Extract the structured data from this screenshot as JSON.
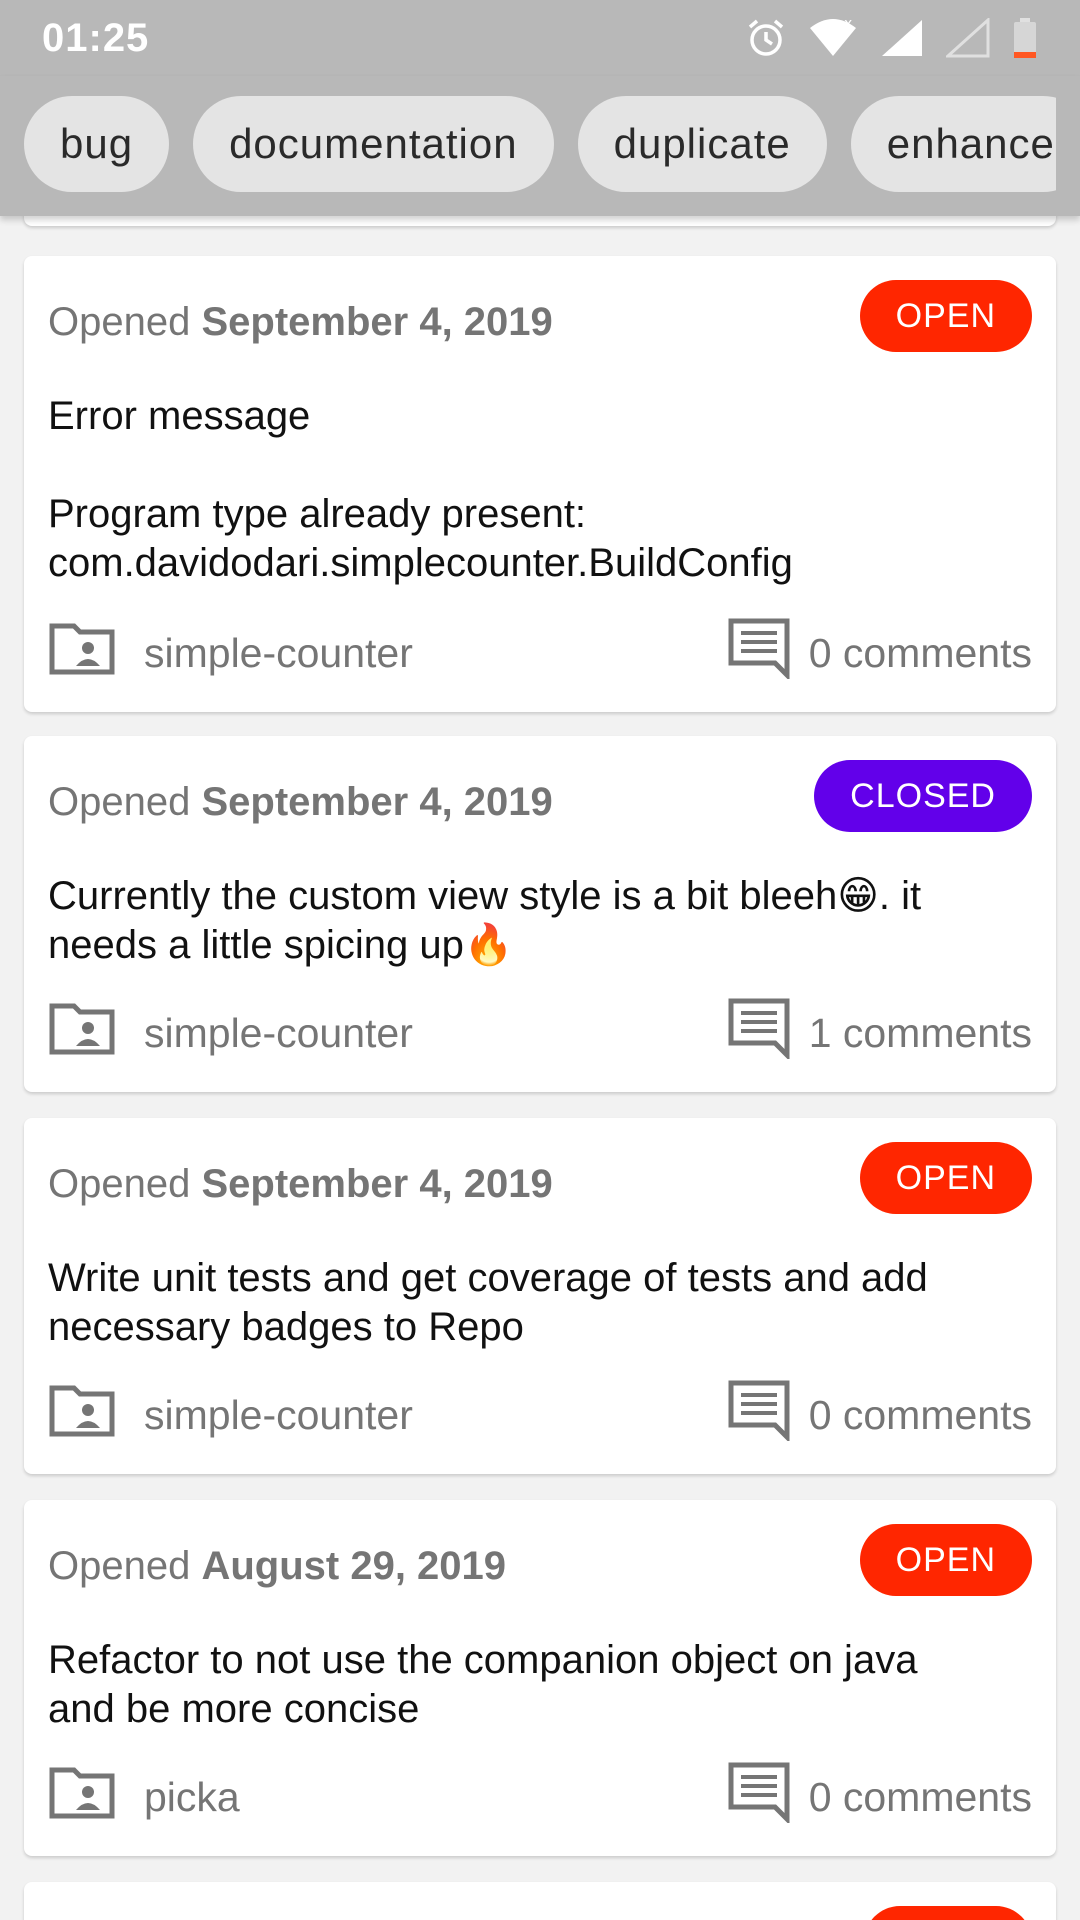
{
  "status_bar": {
    "time": "01:25",
    "icons": [
      "alarm-icon",
      "wifi-icon",
      "signal-icon",
      "signal-empty-icon",
      "battery-low-icon"
    ]
  },
  "label_filters": [
    "bug",
    "documentation",
    "duplicate",
    "enhance"
  ],
  "colors": {
    "open": "#ff2600",
    "closed": "#6200ea",
    "chip_bg": "#e4e4e4",
    "toolbar_bg": "#b8b8b8"
  },
  "issues": [
    {
      "opened_prefix": "Opened",
      "date": "September 4, 2019",
      "state": "OPEN",
      "title_line1": "Error message",
      "title_line2": "",
      "title_line3": "Program type already present:",
      "title_line4": "com.davidodari.simplecounter.BuildConfig",
      "repo": "simple-counter",
      "comments": "0 comments"
    },
    {
      "opened_prefix": "Opened",
      "date": "September 4, 2019",
      "state": "CLOSED",
      "title_part1": "Currently the custom view style is a bit bleeh",
      "emoji1": "😁",
      "title_part2": ". it",
      "title_part3": "needs a little spicing up",
      "emoji2": "🔥",
      "repo": "simple-counter",
      "comments": "1 comments"
    },
    {
      "opened_prefix": "Opened",
      "date": "September 4, 2019",
      "state": "OPEN",
      "title_line1": "Write unit tests and get coverage of tests and add",
      "title_line2": "necessary badges to Repo",
      "repo": "simple-counter",
      "comments": "0 comments"
    },
    {
      "opened_prefix": "Opened",
      "date": "August 29, 2019",
      "state": "OPEN",
      "title_line1": "Refactor to not use the companion object on java",
      "title_line2": "and be more concise",
      "repo": "picka",
      "comments": "0 comments"
    }
  ]
}
